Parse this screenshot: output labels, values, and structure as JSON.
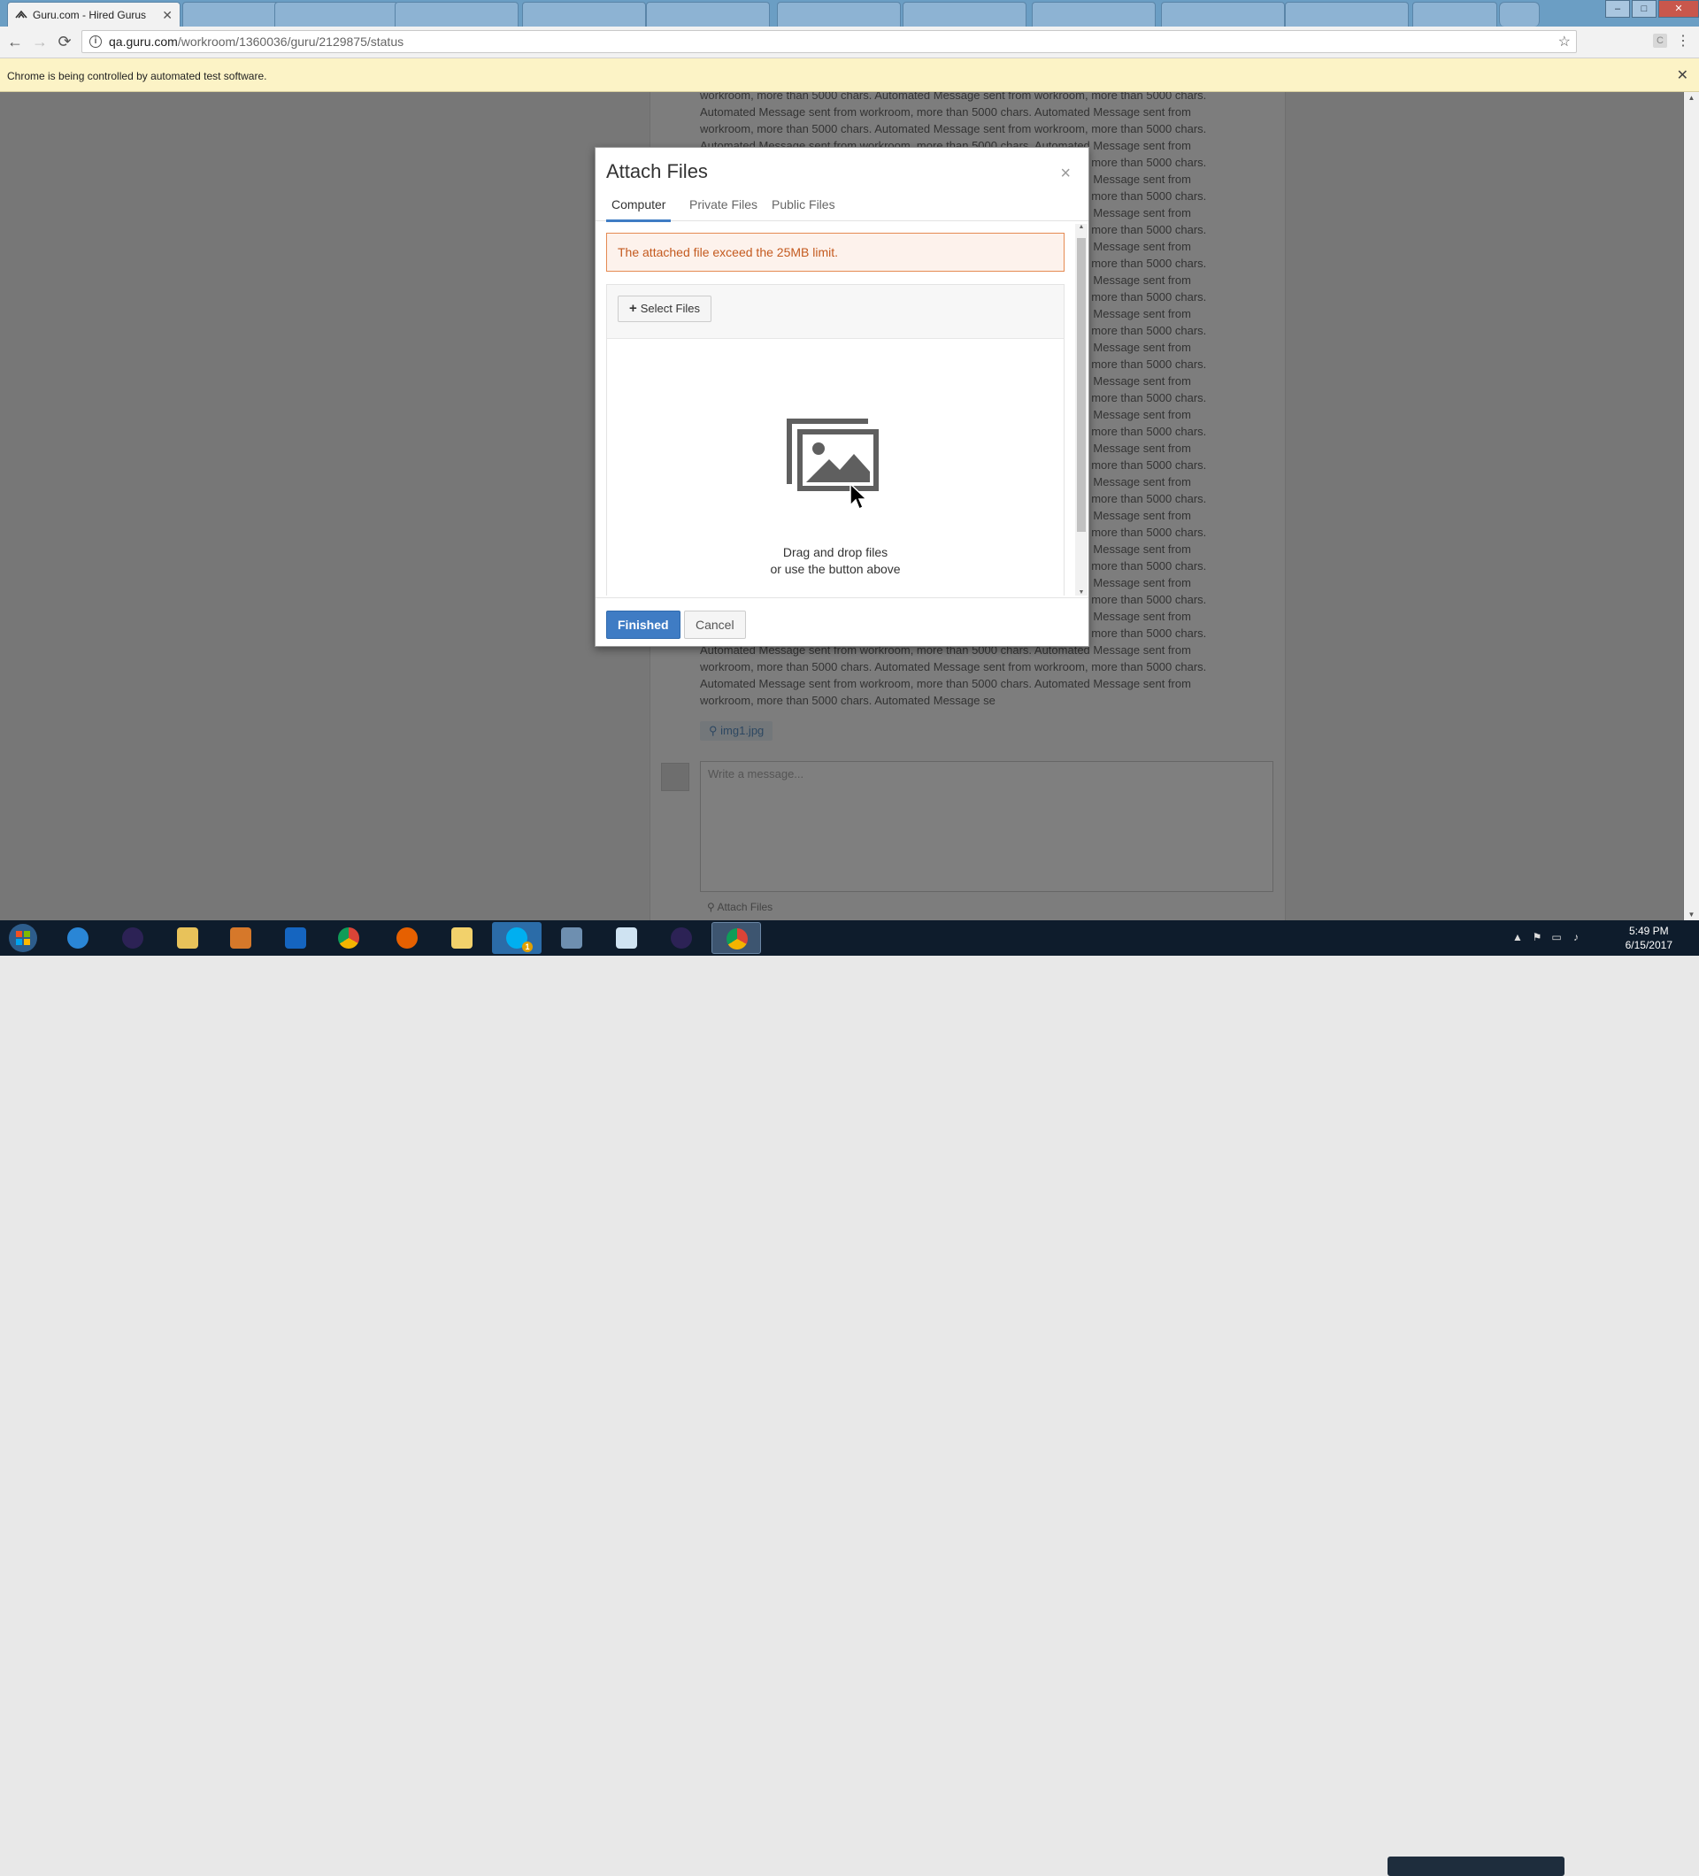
{
  "browser": {
    "active_tab": {
      "title": "Guru.com - Hired Gurus",
      "close": "✕"
    },
    "background_tabs": 10,
    "url_host": "qa.guru.com",
    "url_path": "/workroom/1360036/guru/2129875/status",
    "infobar_text": "Chrome is being controlled by automated test software.",
    "infobar_close": "✕",
    "back": "←",
    "forward": "→",
    "reload": "⟳",
    "star": "☆",
    "menu": "⋮",
    "ext": "C"
  },
  "window_controls": {
    "minimize": "–",
    "maximize": "□",
    "close": "✕"
  },
  "page": {
    "message_lines": [
      "workroom, more than 5000 chars. Automated Message sent from workroom, more than 5000 chars.",
      "Automated Message sent from workroom, more than 5000 chars. Automated Message sent from",
      "workroom, more than 5000 chars. Automated Message sent from workroom, more than 5000 chars.",
      "Automated Message sent from workroom, more than 5000 chars. Automated Message sent from",
      "workroom, more than 5000 chars. Automated Message sent from workroom, more than 5000 chars.",
      "Automated Message sent from workroom, more than 5000 chars. Automated Message sent from",
      "workroom, more than 5000 chars. Automated Message sent from workroom, more than 5000 chars.",
      "Automated Message sent from workroom, more than 5000 chars. Automated Message sent from",
      "workroom, more than 5000 chars. Automated Message sent from workroom, more than 5000 chars.",
      "Automated Message sent from workroom, more than 5000 chars. Automated Message sent from",
      "workroom, more than 5000 chars. Automated Message sent from workroom, more than 5000 chars.",
      "Automated Message sent from workroom, more than 5000 chars. Automated Message sent from",
      "workroom, more than 5000 chars. Automated Message sent from workroom, more than 5000 chars.",
      "Automated Message sent from workroom, more than 5000 chars. Automated Message sent from",
      "workroom, more than 5000 chars. Automated Message sent from workroom, more than 5000 chars.",
      "Automated Message sent from workroom, more than 5000 chars. Automated Message sent from",
      "workroom, more than 5000 chars. Automated Message sent from workroom, more than 5000 chars.",
      "Automated Message sent from workroom, more than 5000 chars. Automated Message sent from",
      "workroom, more than 5000 chars. Automated Message sent from workroom, more than 5000 chars.",
      "Automated Message sent from workroom, more than 5000 chars. Automated Message sent from",
      "workroom, more than 5000 chars. Automated Message sent from workroom, more than 5000 chars.",
      "Automated Message sent from workroom, more than 5000 chars. Automated Message sent from",
      "workroom, more than 5000 chars. Automated Message sent from workroom, more than 5000 chars.",
      "Automated Message sent from workroom, more than 5000 chars. Automated Message sent from",
      "workroom, more than 5000 chars. Automated Message sent from workroom, more than 5000 chars.",
      "Automated Message sent from workroom, more than 5000 chars. Automated Message sent from",
      "workroom, more than 5000 chars. Automated Message sent from workroom, more than 5000 chars.",
      "Automated Message sent from workroom, more than 5000 chars. Automated Message sent from",
      "workroom, more than 5000 chars. Automated Message sent from workroom, more than 5000 chars.",
      "Automated Message sent from workroom, more than 5000 chars. Automated Message sent from",
      "workroom, more than 5000 chars. Automated Message sent from workroom, more than 5000 chars.",
      "Automated Message sent from workroom, more than 5000 chars. Automated Message sent from",
      "workroom, more than 5000 chars. Automated Message sent from workroom, more than 5000 chars.",
      "Automated Message sent from workroom, more than 5000 chars. Automated Message sent from",
      "workroom, more than 5000 chars. Automated Message sent from workroom, more than 5000 chars.",
      "Automated Message sent from workroom, more than 5000 chars. Automated Message sent from",
      "workroom, more than 5000 chars. Automated Message se"
    ],
    "attachment_name": "img1.jpg",
    "reply_placeholder": "Write a message...",
    "attach_files_link": "Attach Files"
  },
  "modal": {
    "title": "Attach Files",
    "close": "×",
    "tabs": [
      "Computer",
      "Private Files",
      "Public Files"
    ],
    "active_tab": "Computer",
    "error": "The attached file exceed the 25MB limit.",
    "select_files": "Select Files",
    "drop_line1": "Drag and drop files",
    "drop_line2": "or use the button above",
    "finished": "Finished",
    "cancel": "Cancel"
  },
  "taskbar": {
    "clock_time": "5:49 PM",
    "clock_date": "6/15/2017",
    "apps": [
      "internet-explorer",
      "eclipse",
      "file-explorer",
      "media-player",
      "outlook",
      "chrome",
      "firefox",
      "folder",
      "skype",
      "control-panel",
      "notepad",
      "eclipse",
      "chrome"
    ],
    "skype_badge": "1"
  },
  "colors": {
    "primary": "#3f7cc4",
    "alert_text": "#c45a1f",
    "alert_border": "#e58a52",
    "infobar": "#fcf3c6"
  }
}
